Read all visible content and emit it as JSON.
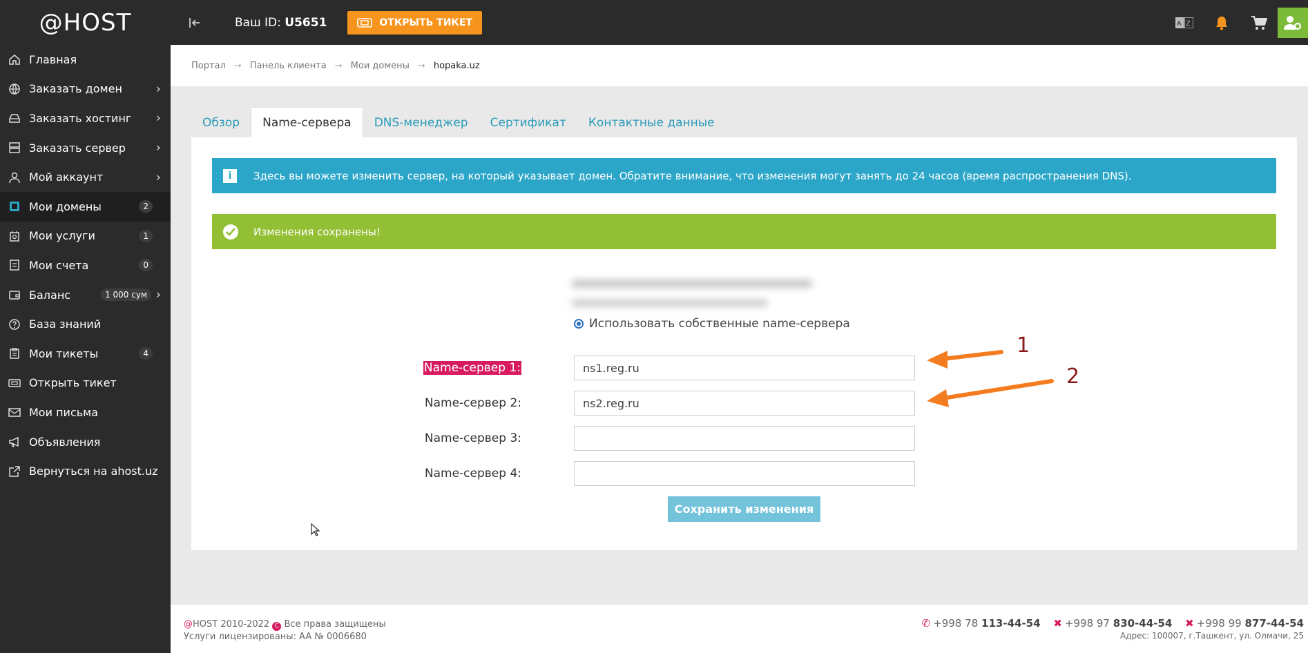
{
  "brand": {
    "logo": "@HOST"
  },
  "sidebar": {
    "items": [
      {
        "label": "Главная",
        "icon": "home-icon",
        "chevron": false,
        "badge": ""
      },
      {
        "label": "Заказать домен",
        "icon": "globe-icon",
        "chevron": true,
        "badge": ""
      },
      {
        "label": "Заказать хостинг",
        "icon": "hdd-icon",
        "chevron": true,
        "badge": ""
      },
      {
        "label": "Заказать сервер",
        "icon": "server-icon",
        "chevron": true,
        "badge": ""
      },
      {
        "label": "Мой аккаунт",
        "icon": "user-icon",
        "chevron": true,
        "badge": ""
      },
      {
        "label": "Мои домены",
        "icon": "domain-icon",
        "chevron": false,
        "badge": "2",
        "active": true
      },
      {
        "label": "Мои услуги",
        "icon": "services-icon",
        "chevron": false,
        "badge": "1"
      },
      {
        "label": "Мои счета",
        "icon": "invoice-icon",
        "chevron": false,
        "badge": "0"
      },
      {
        "label": "Баланс",
        "icon": "wallet-icon",
        "chevron": true,
        "badge": "1 000 сум"
      },
      {
        "label": "База знаний",
        "icon": "question-icon",
        "chevron": false,
        "badge": ""
      },
      {
        "label": "Мои тикеты",
        "icon": "clipboard-icon",
        "chevron": false,
        "badge": "4"
      },
      {
        "label": "Открыть тикет",
        "icon": "ticket-icon",
        "chevron": false,
        "badge": ""
      },
      {
        "label": "Мои письма",
        "icon": "mail-icon",
        "chevron": false,
        "badge": ""
      },
      {
        "label": "Объявления",
        "icon": "megaphone-icon",
        "chevron": false,
        "badge": ""
      },
      {
        "label": "Вернуться на ahost.uz",
        "icon": "external-link-icon",
        "chevron": false,
        "badge": ""
      }
    ]
  },
  "topbar": {
    "id_label": "Ваш ID:",
    "id_value": "U5651",
    "ticket_button": "ОТКРЫТЬ ТИКЕТ"
  },
  "breadcrumb": [
    "Портал",
    "Панель клиента",
    "Мои домены",
    "hopaka.uz"
  ],
  "tabs": [
    "Обзор",
    "Name-сервера",
    "DNS-менеджер",
    "Сертификат",
    "Контактные данные"
  ],
  "active_tab": 1,
  "alerts": {
    "info": "Здесь вы можете изменить сервер, на который указывает домен. Обратите внимание, что изменения могут занять до 24 часов (время распространения DNS).",
    "success": "Изменения сохранены!"
  },
  "form": {
    "radio_label": "Использовать собственные name-сервера",
    "rows": [
      {
        "label": "Name-сервер 1:",
        "value": "ns1.reg.ru",
        "highlight": true
      },
      {
        "label": "Name-сервер 2:",
        "value": "ns2.reg.ru",
        "highlight": false
      },
      {
        "label": "Name-сервер 3:",
        "value": "",
        "highlight": false
      },
      {
        "label": "Name-сервер 4:",
        "value": "",
        "highlight": false
      }
    ],
    "save_button": "Сохранить изменения"
  },
  "annotations": {
    "n1": "1",
    "n2": "2",
    "arrow_color": "#f47c20",
    "number_color": "#8b1a1a"
  },
  "footer": {
    "copyright_at": "@",
    "copyright": "HOST 2010-2022",
    "rights": "Все права защищены",
    "license": "Услуги лицензированы: AA № 0006680",
    "phones": [
      {
        "prefix": "+998 78",
        "number": "113-44-54"
      },
      {
        "prefix": "+998 97",
        "number": "830-44-54"
      },
      {
        "prefix": "+998 99",
        "number": "877-44-54"
      }
    ],
    "address": "Адрес: 100007, г.Ташкент, ул. Олмачи, 25"
  },
  "colors": {
    "accent": "#2a9ab8",
    "ticket": "#f7941d",
    "success": "#93bf34",
    "info": "#2ca6c8",
    "highlight": "#d81b60"
  }
}
